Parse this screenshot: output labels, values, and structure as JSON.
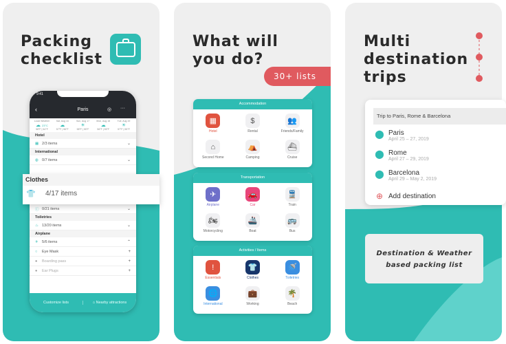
{
  "panel1": {
    "title_line1": "Packing",
    "title_line2": "checklist",
    "phone": {
      "status_time": "9:41",
      "nav_title": "Paris",
      "weather": [
        {
          "day": "Local Weather",
          "temp": "23°C",
          "range": "58°F | 54°F"
        },
        {
          "day": "Sat, Aug 16",
          "range": "57°F | 56°F"
        },
        {
          "day": "Sun, Aug 17",
          "range": "58°F | 55°F"
        },
        {
          "day": "Mon, Aug 18",
          "range": "56°F | 55°F"
        },
        {
          "day": "Tue, Aug 19",
          "range": "57°F | 55°F"
        }
      ],
      "sections": [
        {
          "name": "Hotel",
          "items": "2/3 items"
        },
        {
          "name": "International",
          "items": "0/7 items"
        }
      ],
      "hidden_row": "0/21 items",
      "toiletries": {
        "name": "Toiletries",
        "items": "13/20 items"
      },
      "airplane": {
        "name": "Airplane",
        "items": "5/6 items"
      },
      "checklist": [
        "Eye Mask",
        "Boarding pass",
        "Ear Plugs"
      ],
      "footer": {
        "left": "Customize lists",
        "right": "Nearby attractions"
      }
    },
    "popout": {
      "title": "Clothes",
      "items": "4/17 items"
    }
  },
  "panel2": {
    "title_line1": "What will",
    "title_line2": "you do?",
    "badge": "30+ lists",
    "cards": [
      {
        "header": "Accommodation",
        "items": [
          {
            "label": "Hotel",
            "icon": "hotel-icon",
            "glyph": "▦",
            "bg": "#e0533f",
            "active": true
          },
          {
            "label": "Rental",
            "icon": "dollar-icon",
            "glyph": "$"
          },
          {
            "label": "Friends/Family",
            "icon": "people-icon",
            "glyph": "👥"
          },
          {
            "label": "Second Home",
            "icon": "house-icon",
            "glyph": "⌂"
          },
          {
            "label": "Camping",
            "icon": "tent-icon",
            "glyph": "⛺"
          },
          {
            "label": "Cruise",
            "icon": "ship-icon",
            "glyph": "⛴"
          }
        ]
      },
      {
        "header": "Transportation",
        "items": [
          {
            "label": "Airplane",
            "icon": "airplane-icon",
            "glyph": "✈",
            "bg": "#6e6fc9",
            "active": true
          },
          {
            "label": "Car",
            "icon": "car-icon",
            "glyph": "🚗",
            "bg": "#e8457a",
            "active": true
          },
          {
            "label": "Train",
            "icon": "train-icon",
            "glyph": "🚆"
          },
          {
            "label": "Motorcycling",
            "icon": "motorcycle-icon",
            "glyph": "🏍"
          },
          {
            "label": "Boat",
            "icon": "boat-icon",
            "glyph": "🚢"
          },
          {
            "label": "Bus",
            "icon": "bus-icon",
            "glyph": "🚌"
          }
        ]
      },
      {
        "header": "Activities / Items",
        "items": [
          {
            "label": "Essentials",
            "icon": "alert-icon",
            "glyph": "!",
            "bg": "#e0533f",
            "active": true
          },
          {
            "label": "Clothes",
            "icon": "shirt-icon",
            "glyph": "👕",
            "bg": "#17366b",
            "active": true
          },
          {
            "label": "Toiletries",
            "icon": "shower-icon",
            "glyph": "🚿",
            "bg": "#3a8ee0",
            "active": true
          },
          {
            "label": "International",
            "icon": "globe-icon",
            "glyph": "🌐",
            "bg": "#3a8ee0",
            "active": true
          },
          {
            "label": "Working",
            "icon": "briefcase-icon",
            "glyph": "💼"
          },
          {
            "label": "Beach",
            "icon": "palm-tree-icon",
            "glyph": "🌴"
          }
        ]
      }
    ]
  },
  "panel3": {
    "title_line1": "Multi",
    "title_line2": "destination",
    "title_line3": "trips",
    "trip_name": "Trip to Paris, Rome & Barcelona",
    "destinations": [
      {
        "name": "Paris",
        "dates": "April 25 – 27, 2019"
      },
      {
        "name": "Rome",
        "dates": "April 27 – 29, 2019"
      },
      {
        "name": "Barcelona",
        "dates": "April 29 – May 2, 2019"
      }
    ],
    "add_label": "Add destination",
    "tagline_line1": "Destination & Weather",
    "tagline_line2": "based packing list"
  },
  "colors": {
    "teal": "#2fbcb3",
    "red": "#e05a5f",
    "background": "#efefef"
  }
}
